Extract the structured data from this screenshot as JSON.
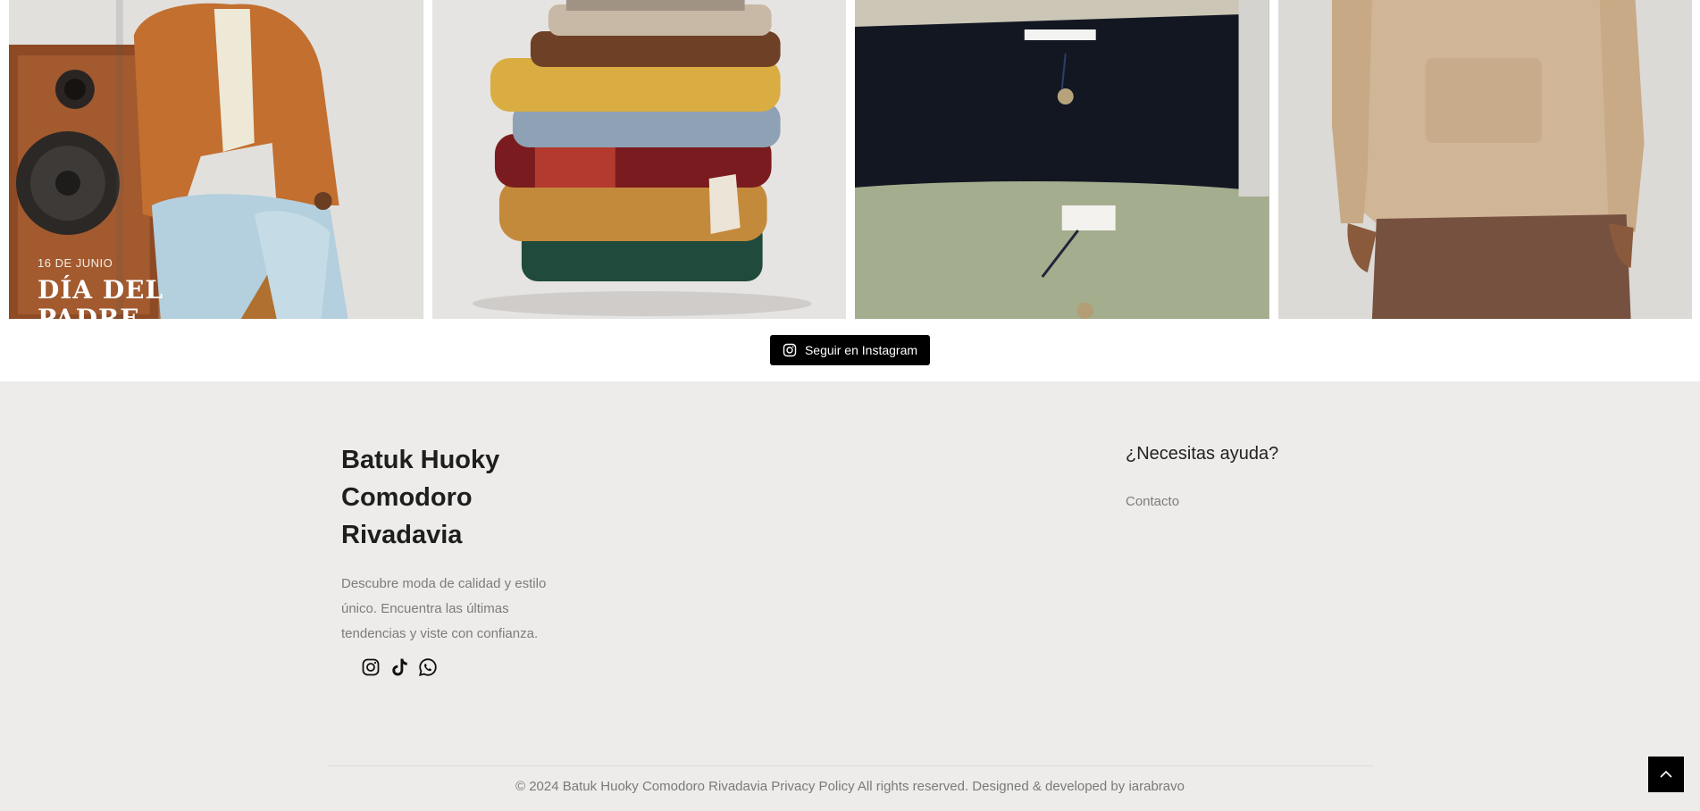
{
  "gallery": {
    "promo": {
      "date": "16 DE JUNIO",
      "title_line1": "DÍA DEL",
      "title_line2": "PADRE"
    },
    "tile_1_label": "instagram-post-dia-del-padre",
    "tile_2_label": "instagram-post-stacked-clothes",
    "tile_3_label": "instagram-post-pants",
    "tile_4_label": "instagram-post-hoodie"
  },
  "follow_button": {
    "label": "Seguir en Instagram",
    "icon": "instagram-icon"
  },
  "footer": {
    "brand_line1": "Batuk Huoky",
    "brand_line2": "Comodoro",
    "brand_line3": "Rivadavia",
    "description_line1": "Descubre moda de calidad y estilo",
    "description_line2": "único. Encuentra las últimas",
    "description_line3": "tendencias y viste con confianza.",
    "socials": [
      "instagram-icon",
      "tiktok-icon",
      "whatsapp-icon"
    ],
    "help_title": "¿Necesitas ayuda?",
    "help_link": "Contacto",
    "copyright_prefix": "© 2024 Batuk Huoky Comodoro Rivadavia",
    "privacy_link": "Privacy Policy",
    "copyright_middle": "All rights reserved. Designed & developed by",
    "developer_link": "iarabravo"
  },
  "back_to_top": {
    "icon": "chevron-up-icon"
  },
  "colors": {
    "footer_bg": "#edecea",
    "button_bg": "#000000",
    "text_muted": "#7c7c7c"
  }
}
